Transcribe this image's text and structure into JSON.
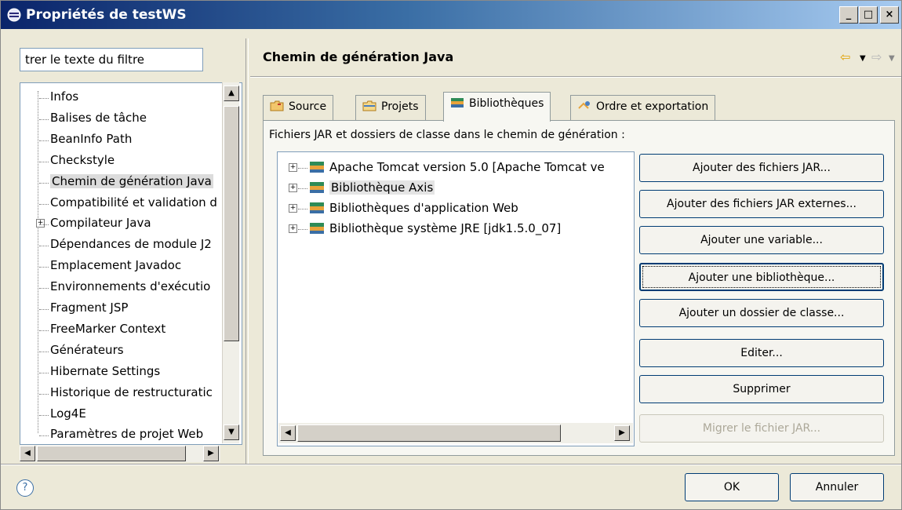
{
  "window": {
    "title": "Propriétés de testWS",
    "min_label": "_",
    "max_label": "□",
    "close_label": "×"
  },
  "filter": {
    "value": "trer le texte du filtre"
  },
  "tree": {
    "items": [
      {
        "label": "Infos"
      },
      {
        "label": "Balises de tâche"
      },
      {
        "label": "BeanInfo Path"
      },
      {
        "label": "Checkstyle"
      },
      {
        "label": "Chemin de génération Java",
        "selected": true
      },
      {
        "label": "Compatibilité et validation d"
      },
      {
        "label": "Compilateur Java",
        "expandable": true
      },
      {
        "label": "Dépendances de module J2"
      },
      {
        "label": "Emplacement Javadoc"
      },
      {
        "label": "Environnements d'exécutio"
      },
      {
        "label": "Fragment JSP"
      },
      {
        "label": "FreeMarker Context"
      },
      {
        "label": "Générateurs"
      },
      {
        "label": "Hibernate Settings"
      },
      {
        "label": "Historique de restructuratic"
      },
      {
        "label": "Log4E"
      },
      {
        "label": "Paramètres de projet Web"
      }
    ]
  },
  "page": {
    "title": "Chemin de génération Java",
    "tabs": [
      {
        "label": "Source"
      },
      {
        "label": "Projets"
      },
      {
        "label": "Bibliothèques",
        "active": true
      },
      {
        "label": "Ordre et exportation"
      }
    ],
    "panel_label": "Fichiers JAR et dossiers de classe dans le chemin de génération :",
    "libraries": [
      {
        "label": "Apache Tomcat version 5.0 [Apache Tomcat ve"
      },
      {
        "label": "Bibliothèque Axis",
        "selected": true
      },
      {
        "label": "Bibliothèques d'application Web"
      },
      {
        "label": "Bibliothèque système JRE [jdk1.5.0_07]"
      }
    ],
    "buttons": {
      "add_jars": "Ajouter des fichiers JAR...",
      "add_external_jars": "Ajouter des fichiers JAR externes...",
      "add_variable": "Ajouter une variable...",
      "add_library": "Ajouter une bibliothèque...",
      "add_class_folder": "Ajouter un dossier de classe...",
      "edit": "Editer...",
      "remove": "Supprimer",
      "migrate_jar": "Migrer le fichier JAR..."
    }
  },
  "footer": {
    "help_label": "?",
    "ok_label": "OK",
    "cancel_label": "Annuler"
  }
}
